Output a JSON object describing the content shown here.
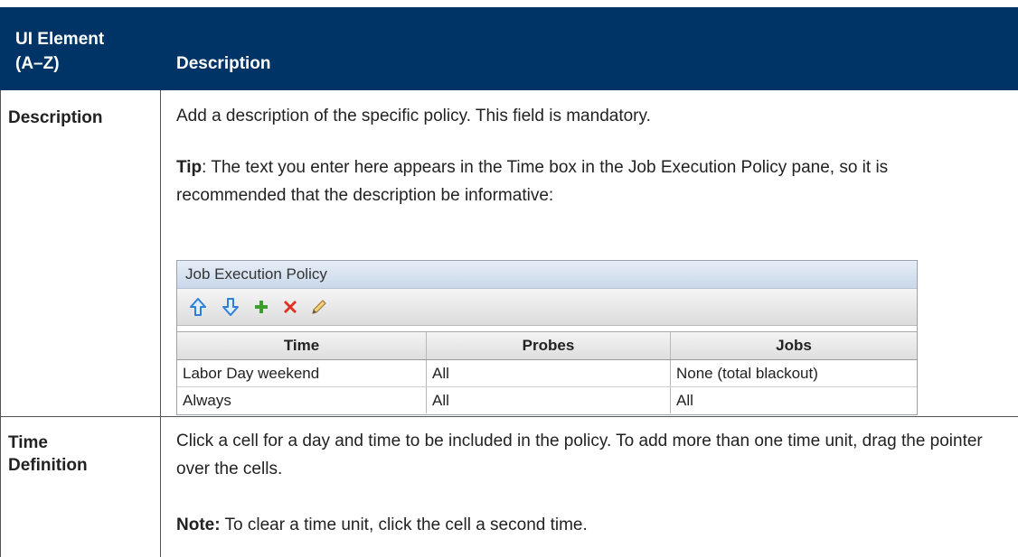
{
  "table": {
    "header": {
      "col1_line1": "UI Element",
      "col1_line2": "(A–Z)",
      "col2": "Description"
    },
    "rows": [
      {
        "element": "Description",
        "paragraphs": [
          {
            "bold": "",
            "text": "Add a description of the specific policy. This field is mandatory."
          },
          {
            "bold": "Tip",
            "text": ": The text you enter here appears in the Time box in the Job Execution Policy pane, so it is recommended that the description be informative:"
          }
        ],
        "screenshot": {
          "title": "Job Execution Policy",
          "toolbar_icons": [
            "move-up-icon",
            "move-down-icon",
            "add-icon",
            "delete-icon",
            "edit-icon"
          ],
          "columns": [
            "Time",
            "Probes",
            "Jobs"
          ],
          "rows": [
            [
              "Labor Day weekend",
              "All",
              "None (total blackout)"
            ],
            [
              "Always",
              "All",
              "All"
            ]
          ]
        }
      },
      {
        "element_line1": "Time",
        "element_line2": "Definition",
        "paragraphs": [
          {
            "bold": "",
            "text": "Click a cell for a day and time to be included in the policy. To add more than one time unit, drag the pointer over the cells."
          },
          {
            "bold": "Note:",
            "text": " To clear a time unit, click the cell a second time."
          }
        ]
      }
    ]
  },
  "colors": {
    "header_bg": "#003466",
    "header_text": "#ffffff",
    "add_icon": "#3aa02a",
    "delete_icon": "#e0301e",
    "arrow_icon": "#2f7fd6"
  }
}
